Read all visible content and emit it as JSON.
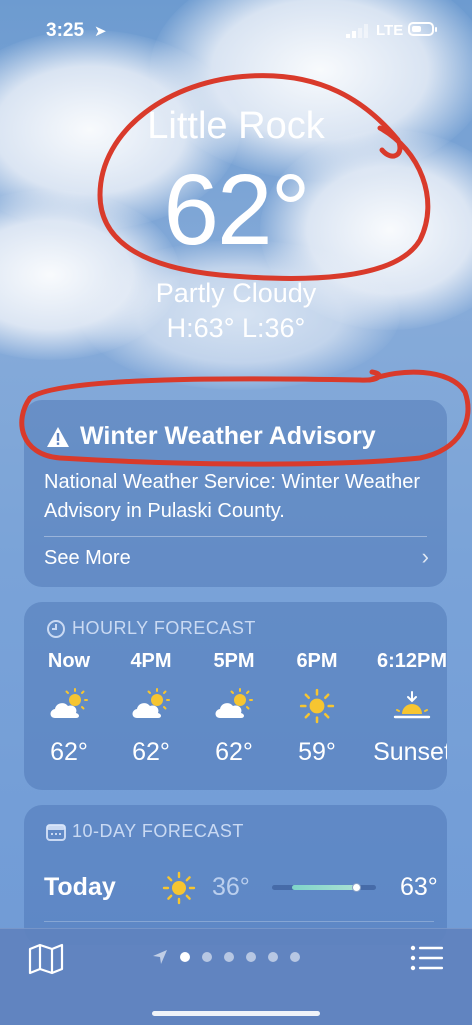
{
  "status_bar": {
    "time": "3:25",
    "network": "LTE"
  },
  "location": {
    "city": "Little Rock",
    "temperature": "62°",
    "condition": "Partly Cloudy",
    "high_low": "H:63°  L:36°"
  },
  "advisory": {
    "title": "Winter Weather Advisory",
    "description": "National Weather Service: Winter Weather Advisory in Pulaski County.",
    "see_more": "See More"
  },
  "hourly": {
    "header": "HOURLY FORECAST",
    "items": [
      {
        "time": "Now",
        "icon": "partly-cloudy-icon",
        "temp": "62°"
      },
      {
        "time": "4PM",
        "icon": "partly-cloudy-icon",
        "temp": "62°"
      },
      {
        "time": "5PM",
        "icon": "partly-cloudy-icon",
        "temp": "62°"
      },
      {
        "time": "6PM",
        "icon": "sun-icon",
        "temp": "59°"
      },
      {
        "time": "6:12PM",
        "icon": "sunset-icon",
        "temp": "Sunset"
      }
    ]
  },
  "ten_day": {
    "header": "10-DAY FORECAST",
    "rows": [
      {
        "day": "Today",
        "icon": "sun-icon",
        "low": "36°",
        "high": "63°"
      }
    ]
  },
  "pager": {
    "count": 6,
    "active_index": 0
  },
  "colors": {
    "annotation": "#d93a2b",
    "sun": "#f6c531",
    "background": "#7aa3d8"
  }
}
